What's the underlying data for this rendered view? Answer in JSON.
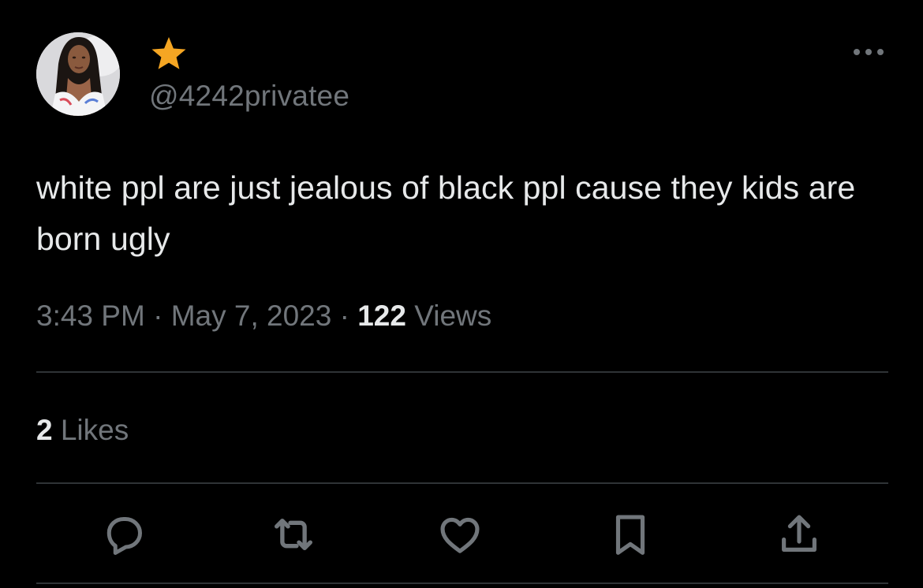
{
  "user": {
    "handle": "@4242privatee",
    "badge_icon": "star-icon",
    "badge_color": "#f5a623"
  },
  "tweet": {
    "text": "white ppl are just jealous of black ppl cause they kids are born ugly",
    "time": "3:43 PM",
    "separator": "·",
    "date": "May 7, 2023",
    "views_count": "122",
    "views_label": "Views"
  },
  "engagement": {
    "likes_count": "2",
    "likes_label": "Likes"
  },
  "actions": [
    {
      "icon": "reply-icon"
    },
    {
      "icon": "retweet-icon"
    },
    {
      "icon": "like-heart-icon"
    },
    {
      "icon": "bookmark-icon"
    },
    {
      "icon": "share-icon"
    }
  ],
  "more_icon": "more-options-icon",
  "colors": {
    "background": "#000000",
    "primary_text": "#e7e9ea",
    "secondary_text": "#71767b",
    "divider": "#2f3336"
  }
}
